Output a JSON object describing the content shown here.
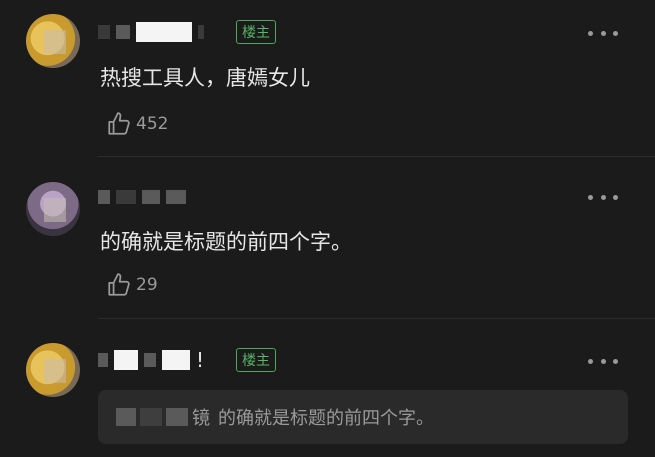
{
  "comments": [
    {
      "op_badge": "楼主",
      "content": "热搜工具人，唐嫣女儿",
      "likes": "452",
      "avatar_icon": "avatar-image"
    },
    {
      "content": "的确就是标题的前四个字。",
      "likes": "29",
      "avatar_icon": "avatar-image"
    },
    {
      "op_badge": "楼主",
      "name_end": "!",
      "quote": {
        "name_end": "镜",
        "text": "的确就是标题的前四个字。"
      }
    }
  ],
  "icons": {
    "like": "thumbs-up-icon",
    "more": "more-options-icon"
  },
  "colors": {
    "background": "#1b1b1c",
    "op_badge": "#58b466",
    "text_primary": "#e6e6e6",
    "text_secondary": "#9a9a9a"
  }
}
